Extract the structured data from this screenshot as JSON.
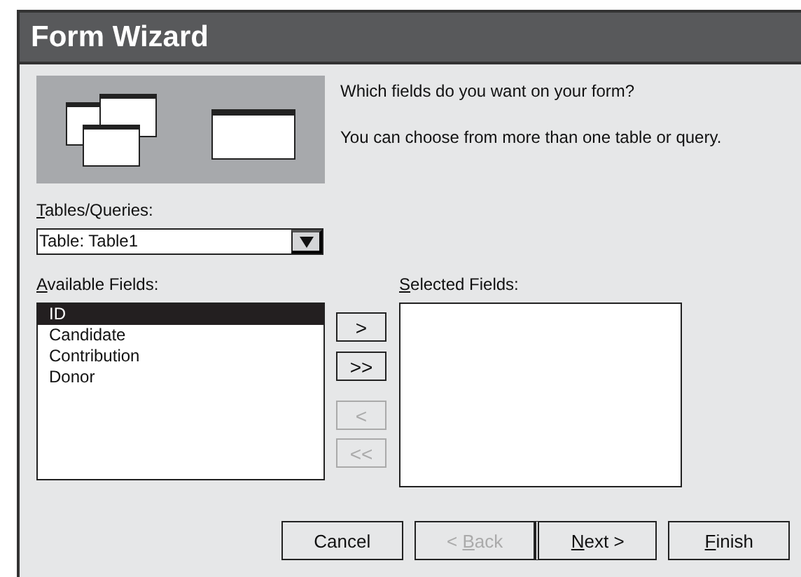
{
  "window": {
    "title": "Form Wizard"
  },
  "intro": [
    "Which fields do you want on your form?",
    "You can choose from more than one table or query."
  ],
  "tables_label": {
    "key": "T",
    "post": "ables/Queries:"
  },
  "tables_combo": {
    "value": "Table: Table1"
  },
  "available_label": {
    "key": "A",
    "post": "vailable Fields:"
  },
  "available_fields": [
    {
      "label": "ID",
      "selected": true
    },
    {
      "label": "Candidate",
      "selected": false
    },
    {
      "label": "Contribution",
      "selected": false
    },
    {
      "label": "Donor",
      "selected": false
    }
  ],
  "move_buttons": [
    {
      "label": ">",
      "disabled": false
    },
    {
      "label": ">>",
      "disabled": false
    },
    {
      "label": "<",
      "disabled": true
    },
    {
      "label": "<<",
      "disabled": true
    }
  ],
  "selected_label": {
    "key": "S",
    "post": "elected Fields:"
  },
  "buttons": [
    {
      "pre": "Cancel",
      "disabled": false,
      "default": false
    },
    {
      "pre": "< ",
      "key": "B",
      "post": "ack",
      "disabled": true,
      "default": false
    },
    {
      "key": "N",
      "post": "ext >",
      "disabled": false,
      "default": true
    },
    {
      "key": "F",
      "post": "inish",
      "disabled": false,
      "default": false
    }
  ]
}
